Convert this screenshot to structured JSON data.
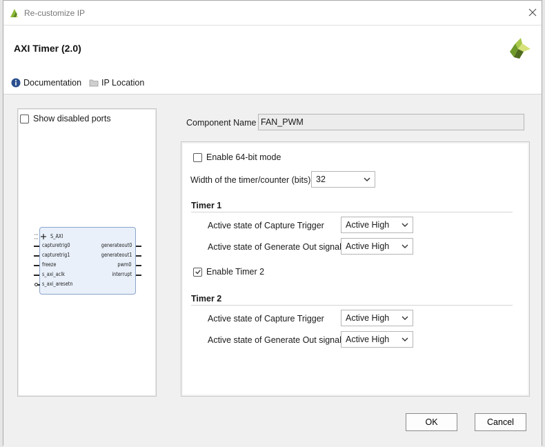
{
  "window": {
    "title": "Re-customize IP",
    "ip_name": "AXI Timer (2.0)"
  },
  "links": {
    "documentation": "Documentation",
    "ip_location": "IP Location"
  },
  "preview": {
    "show_disabled_ports": "Show disabled ports",
    "show_disabled_checked": false,
    "bus_port": "S_AXI",
    "left_ports": [
      "capturetrig0",
      "capturetrig1",
      "freeze",
      "s_axi_aclk",
      "s_axi_aresetn"
    ],
    "right_ports": [
      "generateout0",
      "generateout1",
      "pwm0",
      "interrupt"
    ]
  },
  "component": {
    "label": "Component Name",
    "value": "FAN_PWM"
  },
  "config": {
    "enable_64bit": {
      "label": "Enable 64-bit mode",
      "checked": false
    },
    "width": {
      "label": "Width of the timer/counter (bits)",
      "value": "32"
    },
    "timer1": {
      "heading": "Timer 1",
      "capture_label": "Active state of Capture Trigger",
      "capture_value": "Active High",
      "generate_label": "Active state of Generate Out signal",
      "generate_value": "Active High"
    },
    "enable_timer2": {
      "label": "Enable Timer 2",
      "checked": true
    },
    "timer2": {
      "heading": "Timer 2",
      "capture_label": "Active state of Capture Trigger",
      "capture_value": "Active High",
      "generate_label": "Active state of Generate Out signal",
      "generate_value": "Active High"
    }
  },
  "buttons": {
    "ok": "OK",
    "cancel": "Cancel"
  },
  "colors": {
    "brand_green": "#8cba33",
    "brand_dark": "#4f6b1d",
    "info_blue": "#2b4f8e"
  }
}
